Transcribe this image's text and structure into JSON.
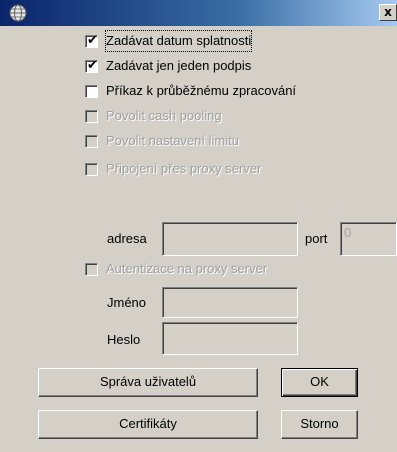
{
  "window": {
    "title": "",
    "close_label": "x",
    "app_icon": "globe-icon"
  },
  "options": [
    {
      "label": "Zadávat datum splatnosti",
      "checked": true,
      "enabled": true
    },
    {
      "label": "Zadávat jen jeden podpis",
      "checked": true,
      "enabled": true
    },
    {
      "label": "Příkaz k průběžnému zpracování",
      "checked": false,
      "enabled": true
    },
    {
      "label": "Povolit cash pooling",
      "checked": false,
      "enabled": false
    },
    {
      "label": "Povolit nastavení limitu",
      "checked": false,
      "enabled": false
    },
    {
      "label": "Připojení přes proxy server",
      "checked": false,
      "enabled": false
    }
  ],
  "proxy": {
    "address_label": "adresa",
    "address_value": "",
    "port_label": "port",
    "port_value": "0"
  },
  "auth": {
    "label": "Autentizace na proxy server",
    "checked": false,
    "enabled": false,
    "name_label": "Jméno",
    "name_value": "",
    "password_label": "Heslo",
    "password_value": ""
  },
  "buttons": {
    "users": "Správa uživatelů",
    "ok": "OK",
    "certificates": "Certifikáty",
    "cancel": "Storno"
  }
}
